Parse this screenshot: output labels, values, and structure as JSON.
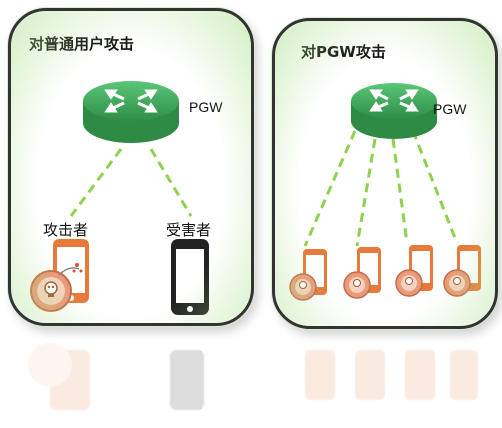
{
  "left_panel": {
    "title": "对普通用户攻击",
    "router_label": "PGW",
    "attacker_label": "攻击者",
    "victim_label": "受害者"
  },
  "right_panel": {
    "title": "对PGW攻击",
    "router_label": "PGW"
  },
  "colors": {
    "router_green": "#3daa5a",
    "link_dash": "#8fd14f",
    "phone_orange": "#e8793a",
    "phone_black": "#222222",
    "panel_glow": "#b8e6a0"
  },
  "icons": [
    "router-icon",
    "attacker-phone-icon",
    "victim-phone-icon",
    "bomb-icon"
  ]
}
